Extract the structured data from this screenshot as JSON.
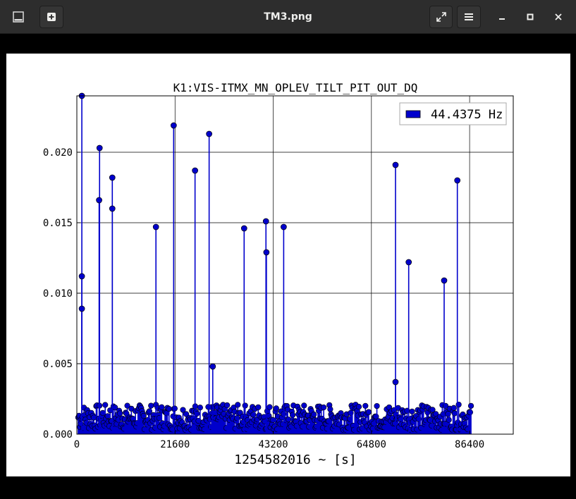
{
  "window": {
    "title": "TM3.png",
    "icons": [
      "image-icon",
      "new-tab-icon",
      "fullscreen-icon",
      "menu-icon",
      "minimize-icon",
      "maximize-icon",
      "close-icon"
    ]
  },
  "chart_data": {
    "type": "stem",
    "title": "K1:VIS-ITMX_MN_OPLEV_TILT_PIT_OUT_DQ",
    "xlabel": "1254582016 ~ [s]",
    "ylabel": "",
    "xlim": [
      0,
      96000
    ],
    "ylim": [
      0,
      0.024
    ],
    "xticks": [
      0,
      21600,
      43200,
      64800,
      86400
    ],
    "xtick_labels": [
      "0",
      "21600",
      "43200",
      "64800",
      "86400"
    ],
    "yticks": [
      0.0,
      0.005,
      0.01,
      0.015,
      0.02
    ],
    "ytick_labels": [
      "0.000",
      "0.005",
      "0.010",
      "0.015",
      "0.020"
    ],
    "grid": true,
    "legend": {
      "position": "top-right",
      "entries": [
        "44.4375 Hz"
      ]
    },
    "series": [
      {
        "name": "44.4375 Hz",
        "color": "#0000cc",
        "peaks": [
          {
            "x": 1100,
            "y": 0.024
          },
          {
            "x": 1100,
            "y": 0.0112
          },
          {
            "x": 1100,
            "y": 0.0089
          },
          {
            "x": 5000,
            "y": 0.0203
          },
          {
            "x": 4900,
            "y": 0.0166
          },
          {
            "x": 7800,
            "y": 0.0182
          },
          {
            "x": 7800,
            "y": 0.016
          },
          {
            "x": 17400,
            "y": 0.0147
          },
          {
            "x": 21300,
            "y": 0.0219
          },
          {
            "x": 26000,
            "y": 0.0187
          },
          {
            "x": 29100,
            "y": 0.0213
          },
          {
            "x": 29900,
            "y": 0.0048
          },
          {
            "x": 36800,
            "y": 0.0146
          },
          {
            "x": 41600,
            "y": 0.0151
          },
          {
            "x": 41700,
            "y": 0.0129
          },
          {
            "x": 45500,
            "y": 0.0147
          },
          {
            "x": 70100,
            "y": 0.0191
          },
          {
            "x": 70100,
            "y": 0.0037
          },
          {
            "x": 73000,
            "y": 0.0122
          },
          {
            "x": 80800,
            "y": 0.0109
          },
          {
            "x": 83700,
            "y": 0.018
          }
        ],
        "baseline": {
          "x_start": 300,
          "x_end": 86800,
          "step": 180,
          "y_min": 0.0003,
          "y_max": 0.0021
        }
      }
    ]
  }
}
